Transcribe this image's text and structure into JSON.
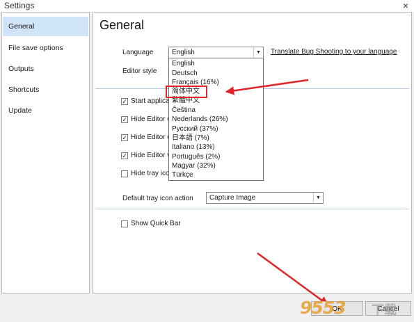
{
  "window": {
    "title": "Settings",
    "close_icon": "×"
  },
  "sidebar": {
    "items": [
      {
        "label": "General",
        "active": true
      },
      {
        "label": "File save options"
      },
      {
        "label": "Outputs"
      },
      {
        "label": "Shortcuts"
      },
      {
        "label": "Update"
      }
    ]
  },
  "main": {
    "heading": "General",
    "language": {
      "label": "Language",
      "value": "English",
      "link": "Translate Bug Shooting to your language"
    },
    "editor_style": {
      "label": "Editor style"
    },
    "checkboxes": [
      {
        "label": "Start applica",
        "checked": true
      },
      {
        "label": "Hide Editor o",
        "checked": true
      },
      {
        "label": "Hide Editor o",
        "checked": true
      },
      {
        "label": "Hide Editor v",
        "checked": true
      },
      {
        "label": "Hide tray ico",
        "checked": false
      }
    ],
    "tray_action": {
      "label": "Default tray icon action",
      "value": "Capture Image"
    },
    "show_quick_bar": {
      "label": "Show Quick Bar",
      "checked": false
    }
  },
  "language_dropdown": {
    "options": [
      "English",
      "Deutsch",
      "Français (16%)",
      "简体中文",
      "繁體中文",
      "Čeština",
      "Nederlands (26%)",
      "Русский (37%)",
      "日本語 (7%)",
      "Italiano (13%)",
      "Português (2%)",
      "Magyar (32%)",
      "Türkçe"
    ]
  },
  "footer": {
    "ok": "OK",
    "cancel": "Cancel"
  },
  "watermark": {
    "text": "9553",
    "suffix": "下载"
  },
  "colors": {
    "selected": "#d0e4f7",
    "annotation_red": "#e0242a",
    "separator": "#b7c9dc"
  }
}
